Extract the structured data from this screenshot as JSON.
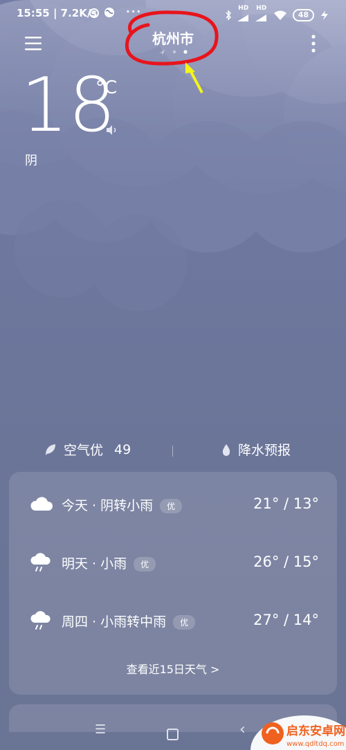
{
  "status_bar": {
    "time_speed": "15:55 | 7.2K/s",
    "overflow_dots": "···",
    "hd_label": "HD",
    "battery": "48"
  },
  "header": {
    "city": "杭州市"
  },
  "current": {
    "temperature": "18",
    "unit": "°C",
    "condition": "阴"
  },
  "info": {
    "air_quality_label": "空气优",
    "air_quality_value": "49",
    "precip_label": "降水预报"
  },
  "forecast": {
    "days": [
      {
        "label": "今天 · 阴转小雨",
        "badge": "优",
        "temp": "21° / 13°",
        "icon": "cloud-icon"
      },
      {
        "label": "明天 · 小雨",
        "badge": "优",
        "temp": "26° / 15°",
        "icon": "light-rain-icon"
      },
      {
        "label": "周四 · 小雨转中雨",
        "badge": "优",
        "temp": "27° / 14°",
        "icon": "light-rain-icon"
      }
    ],
    "more_link": "查看近15日天气 >"
  },
  "watermark": {
    "text": "启东安卓网",
    "url": "www.qdltdq.com"
  },
  "colors": {
    "annotation_red": "#e8141c",
    "annotation_yellow": "#f5f518",
    "watermark_orange": "#f0611f"
  }
}
